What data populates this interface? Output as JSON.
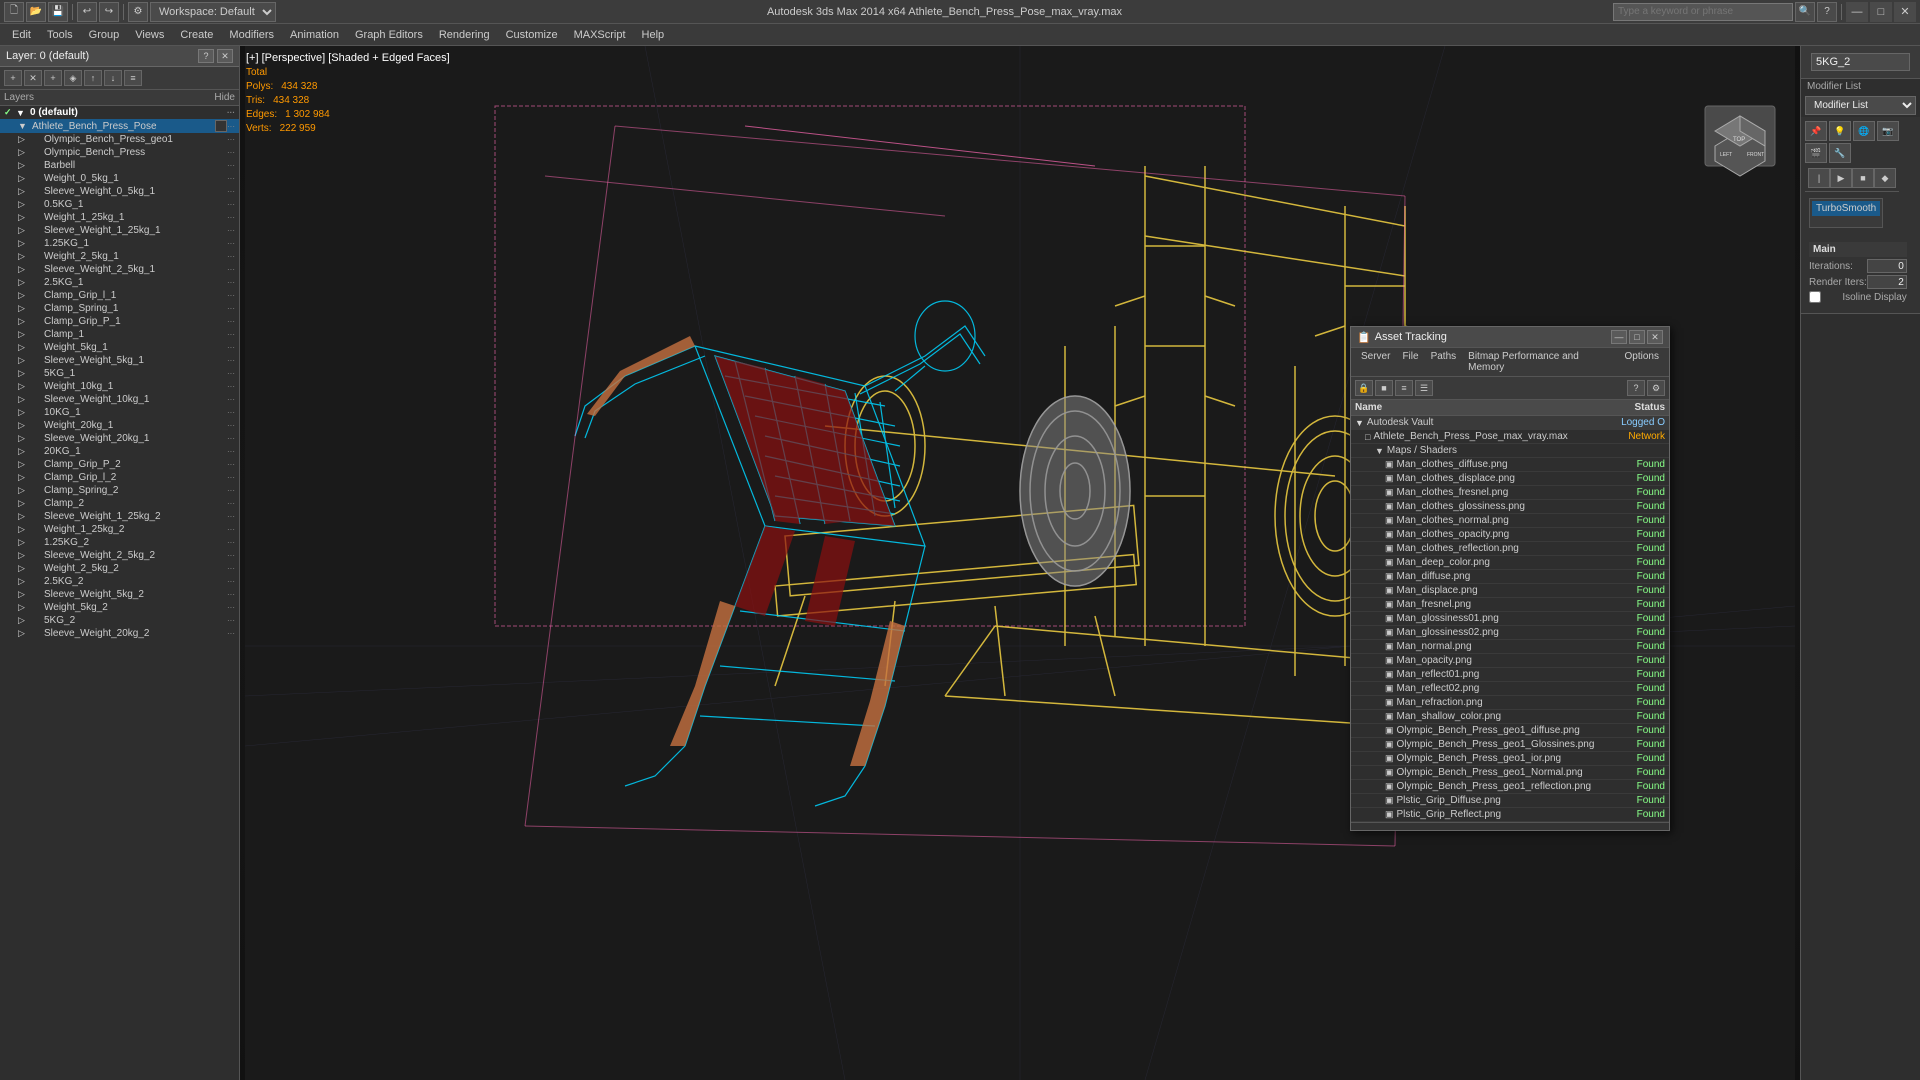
{
  "window": {
    "title": "Autodesk 3ds Max 2014 x64     Athlete_Bench_Press_Pose_max_vray.max",
    "search_placeholder": "Type a keyword or phrase",
    "minimize": "—",
    "maximize": "□",
    "close": "✕"
  },
  "toolbar": {
    "workspace_label": "Workspace: Default"
  },
  "menu": {
    "items": [
      "Edit",
      "Tools",
      "Group",
      "Views",
      "Create",
      "Modifiers",
      "Animation",
      "Graph Editors",
      "Rendering",
      "Customize",
      "MAXScript",
      "Help"
    ]
  },
  "viewport": {
    "label": "[+] [Perspective] [Shaded + Edged Faces]",
    "stats": {
      "polys_label": "Polys:",
      "polys_value": "434 328",
      "tris_label": "Tris:",
      "tris_value": "434 328",
      "edges_label": "Edges:",
      "edges_value": "1 302 984",
      "verts_label": "Verts:",
      "verts_value": "222 959"
    }
  },
  "layers_panel": {
    "title": "Layer: 0 (default)",
    "help_btn": "?",
    "close_btn": "✕",
    "columns": {
      "layers": "Layers",
      "hide": "Hide"
    },
    "items": [
      {
        "name": "0 (default)",
        "level": 0,
        "check": "✓",
        "parent": true
      },
      {
        "name": "Athlete_Bench_Press_Pose",
        "level": 0,
        "selected": true,
        "has_checkbox": true
      },
      {
        "name": "Olympic_Bench_Press_geo1",
        "level": 1
      },
      {
        "name": "Olympic_Bench_Press",
        "level": 1
      },
      {
        "name": "Barbell",
        "level": 1
      },
      {
        "name": "Weight_0_5kg_1",
        "level": 1
      },
      {
        "name": "Sleeve_Weight_0_5kg_1",
        "level": 1
      },
      {
        "name": "0.5KG_1",
        "level": 1
      },
      {
        "name": "Weight_1_25kg_1",
        "level": 1
      },
      {
        "name": "Sleeve_Weight_1_25kg_1",
        "level": 1
      },
      {
        "name": "1.25KG_1",
        "level": 1
      },
      {
        "name": "Weight_2_5kg_1",
        "level": 1
      },
      {
        "name": "Sleeve_Weight_2_5kg_1",
        "level": 1
      },
      {
        "name": "2.5KG_1",
        "level": 1
      },
      {
        "name": "Clamp_Grip_l_1",
        "level": 1
      },
      {
        "name": "Clamp_Spring_1",
        "level": 1
      },
      {
        "name": "Clamp_Grip_P_1",
        "level": 1
      },
      {
        "name": "Clamp_1",
        "level": 1
      },
      {
        "name": "Weight_5kg_1",
        "level": 1
      },
      {
        "name": "Sleeve_Weight_5kg_1",
        "level": 1
      },
      {
        "name": "5KG_1",
        "level": 1
      },
      {
        "name": "Weight_10kg_1",
        "level": 1
      },
      {
        "name": "Sleeve_Weight_10kg_1",
        "level": 1
      },
      {
        "name": "10KG_1",
        "level": 1
      },
      {
        "name": "Weight_20kg_1",
        "level": 1
      },
      {
        "name": "Sleeve_Weight_20kg_1",
        "level": 1
      },
      {
        "name": "20KG_1",
        "level": 1
      },
      {
        "name": "Clamp_Grip_P_2",
        "level": 1
      },
      {
        "name": "Clamp_Grip_l_2",
        "level": 1
      },
      {
        "name": "Clamp_Spring_2",
        "level": 1
      },
      {
        "name": "Clamp_2",
        "level": 1
      },
      {
        "name": "Sleeve_Weight_1_25kg_2",
        "level": 1
      },
      {
        "name": "Weight_1_25kg_2",
        "level": 1
      },
      {
        "name": "1.25KG_2",
        "level": 1
      },
      {
        "name": "Sleeve_Weight_2_5kg_2",
        "level": 1
      },
      {
        "name": "Weight_2_5kg_2",
        "level": 1
      },
      {
        "name": "2.5KG_2",
        "level": 1
      },
      {
        "name": "Sleeve_Weight_5kg_2",
        "level": 1
      },
      {
        "name": "Weight_5kg_2",
        "level": 1
      },
      {
        "name": "5KG_2",
        "level": 1
      },
      {
        "name": "Sleeve_Weight_20kg_2",
        "level": 1
      }
    ]
  },
  "modifier_panel": {
    "object_name": "5KG_2",
    "modifier_list_label": "Modifier List",
    "modifier_name": "TurboSmooth",
    "prop_section": "Main",
    "iterations_label": "Iterations:",
    "iterations_value": "0",
    "render_iters_label": "Render Iters:",
    "render_iters_value": "2",
    "isoline_label": "Isoline Display"
  },
  "asset_tracking": {
    "title": "Asset Tracking",
    "menu_items": [
      "Server",
      "File",
      "Paths",
      "Bitmap Performance and Memory",
      "Options"
    ],
    "col_name": "Name",
    "col_status": "Status",
    "rows": [
      {
        "name": "Autodesk Vault",
        "level": 0,
        "status": "Logged O",
        "status_type": "logged",
        "icon": "▼"
      },
      {
        "name": "Athlete_Bench_Press_Pose_max_vray.max",
        "level": 1,
        "status": "Network",
        "status_type": "network",
        "icon": "□"
      },
      {
        "name": "Maps / Shaders",
        "level": 2,
        "status": "",
        "status_type": "",
        "icon": "▼"
      },
      {
        "name": "Man_clothes_diffuse.png",
        "level": 3,
        "status": "Found",
        "status_type": "found",
        "icon": "▣"
      },
      {
        "name": "Man_clothes_displace.png",
        "level": 3,
        "status": "Found",
        "status_type": "found",
        "icon": "▣"
      },
      {
        "name": "Man_clothes_fresnel.png",
        "level": 3,
        "status": "Found",
        "status_type": "found",
        "icon": "▣"
      },
      {
        "name": "Man_clothes_glossiness.png",
        "level": 3,
        "status": "Found",
        "status_type": "found",
        "icon": "▣"
      },
      {
        "name": "Man_clothes_normal.png",
        "level": 3,
        "status": "Found",
        "status_type": "found",
        "icon": "▣"
      },
      {
        "name": "Man_clothes_opacity.png",
        "level": 3,
        "status": "Found",
        "status_type": "found",
        "icon": "▣"
      },
      {
        "name": "Man_clothes_reflection.png",
        "level": 3,
        "status": "Found",
        "status_type": "found",
        "icon": "▣"
      },
      {
        "name": "Man_deep_color.png",
        "level": 3,
        "status": "Found",
        "status_type": "found",
        "icon": "▣"
      },
      {
        "name": "Man_diffuse.png",
        "level": 3,
        "status": "Found",
        "status_type": "found",
        "icon": "▣"
      },
      {
        "name": "Man_displace.png",
        "level": 3,
        "status": "Found",
        "status_type": "found",
        "icon": "▣"
      },
      {
        "name": "Man_fresnel.png",
        "level": 3,
        "status": "Found",
        "status_type": "found",
        "icon": "▣"
      },
      {
        "name": "Man_glossiness01.png",
        "level": 3,
        "status": "Found",
        "status_type": "found",
        "icon": "▣"
      },
      {
        "name": "Man_glossiness02.png",
        "level": 3,
        "status": "Found",
        "status_type": "found",
        "icon": "▣"
      },
      {
        "name": "Man_normal.png",
        "level": 3,
        "status": "Found",
        "status_type": "found",
        "icon": "▣"
      },
      {
        "name": "Man_opacity.png",
        "level": 3,
        "status": "Found",
        "status_type": "found",
        "icon": "▣"
      },
      {
        "name": "Man_reflect01.png",
        "level": 3,
        "status": "Found",
        "status_type": "found",
        "icon": "▣"
      },
      {
        "name": "Man_reflect02.png",
        "level": 3,
        "status": "Found",
        "status_type": "found",
        "icon": "▣"
      },
      {
        "name": "Man_refraction.png",
        "level": 3,
        "status": "Found",
        "status_type": "found",
        "icon": "▣"
      },
      {
        "name": "Man_shallow_color.png",
        "level": 3,
        "status": "Found",
        "status_type": "found",
        "icon": "▣"
      },
      {
        "name": "Olympic_Bench_Press_geo1_diffuse.png",
        "level": 3,
        "status": "Found",
        "status_type": "found",
        "icon": "▣"
      },
      {
        "name": "Olympic_Bench_Press_geo1_Glossines.png",
        "level": 3,
        "status": "Found",
        "status_type": "found",
        "icon": "▣"
      },
      {
        "name": "Olympic_Bench_Press_geo1_ior.png",
        "level": 3,
        "status": "Found",
        "status_type": "found",
        "icon": "▣"
      },
      {
        "name": "Olympic_Bench_Press_geo1_Normal.png",
        "level": 3,
        "status": "Found",
        "status_type": "found",
        "icon": "▣"
      },
      {
        "name": "Olympic_Bench_Press_geo1_reflection.png",
        "level": 3,
        "status": "Found",
        "status_type": "found",
        "icon": "▣"
      },
      {
        "name": "Plstic_Grip_Diffuse.png",
        "level": 3,
        "status": "Found",
        "status_type": "found",
        "icon": "▣"
      },
      {
        "name": "Plstic_Grip_Reflect.png",
        "level": 3,
        "status": "Found",
        "status_type": "found",
        "icon": "▣"
      }
    ]
  }
}
